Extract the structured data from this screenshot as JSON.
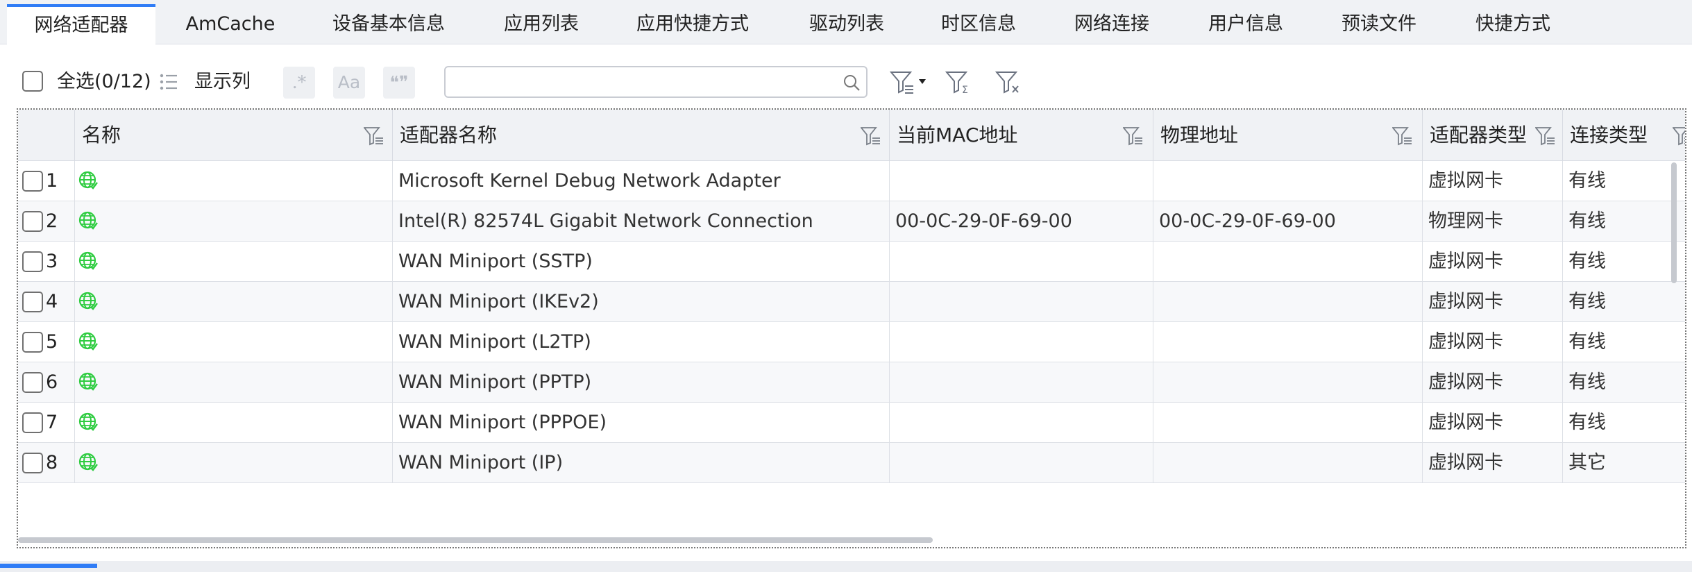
{
  "tabs": [
    {
      "label": "网络适配器",
      "active": true
    },
    {
      "label": "AmCache"
    },
    {
      "label": "设备基本信息"
    },
    {
      "label": "应用列表"
    },
    {
      "label": "应用快捷方式"
    },
    {
      "label": "驱动列表"
    },
    {
      "label": "时区信息"
    },
    {
      "label": "网络连接"
    },
    {
      "label": "用户信息"
    },
    {
      "label": "预读文件"
    },
    {
      "label": "快捷方式"
    }
  ],
  "toolbar": {
    "select_all_label": "全选(0/12)",
    "show_columns_label": "显示列",
    "regex_button": ".*",
    "match_case_button": "Aa",
    "whole_word_button": "❝❞",
    "search_value": "",
    "search_placeholder": ""
  },
  "table": {
    "columns": [
      "名称",
      "适配器名称",
      "当前MAC地址",
      "物理地址",
      "适配器类型",
      "连接类型"
    ],
    "rows": [
      {
        "num": "1",
        "adapter_name": "Microsoft Kernel Debug Network Adapter",
        "mac": "",
        "physical": "",
        "type": "虚拟网卡",
        "conn": "有线"
      },
      {
        "num": "2",
        "adapter_name": "Intel(R) 82574L Gigabit Network Connection",
        "mac": "00-0C-29-0F-69-00",
        "physical": "00-0C-29-0F-69-00",
        "type": "物理网卡",
        "conn": "有线"
      },
      {
        "num": "3",
        "adapter_name": "WAN Miniport (SSTP)",
        "mac": "",
        "physical": "",
        "type": "虚拟网卡",
        "conn": "有线"
      },
      {
        "num": "4",
        "adapter_name": "WAN Miniport (IKEv2)",
        "mac": "",
        "physical": "",
        "type": "虚拟网卡",
        "conn": "有线"
      },
      {
        "num": "5",
        "adapter_name": "WAN Miniport (L2TP)",
        "mac": "",
        "physical": "",
        "type": "虚拟网卡",
        "conn": "有线"
      },
      {
        "num": "6",
        "adapter_name": "WAN Miniport (PPTP)",
        "mac": "",
        "physical": "",
        "type": "虚拟网卡",
        "conn": "有线"
      },
      {
        "num": "7",
        "adapter_name": "WAN Miniport (PPPOE)",
        "mac": "",
        "physical": "",
        "type": "虚拟网卡",
        "conn": "有线"
      },
      {
        "num": "8",
        "adapter_name": "WAN Miniport (IP)",
        "mac": "",
        "physical": "",
        "type": "虚拟网卡",
        "conn": "其它"
      }
    ]
  },
  "icons": {
    "row_icon": "globe-icon",
    "filter": "filter-icon"
  },
  "colors": {
    "accent": "#2f7cf6",
    "globe": "#2ecc40"
  }
}
